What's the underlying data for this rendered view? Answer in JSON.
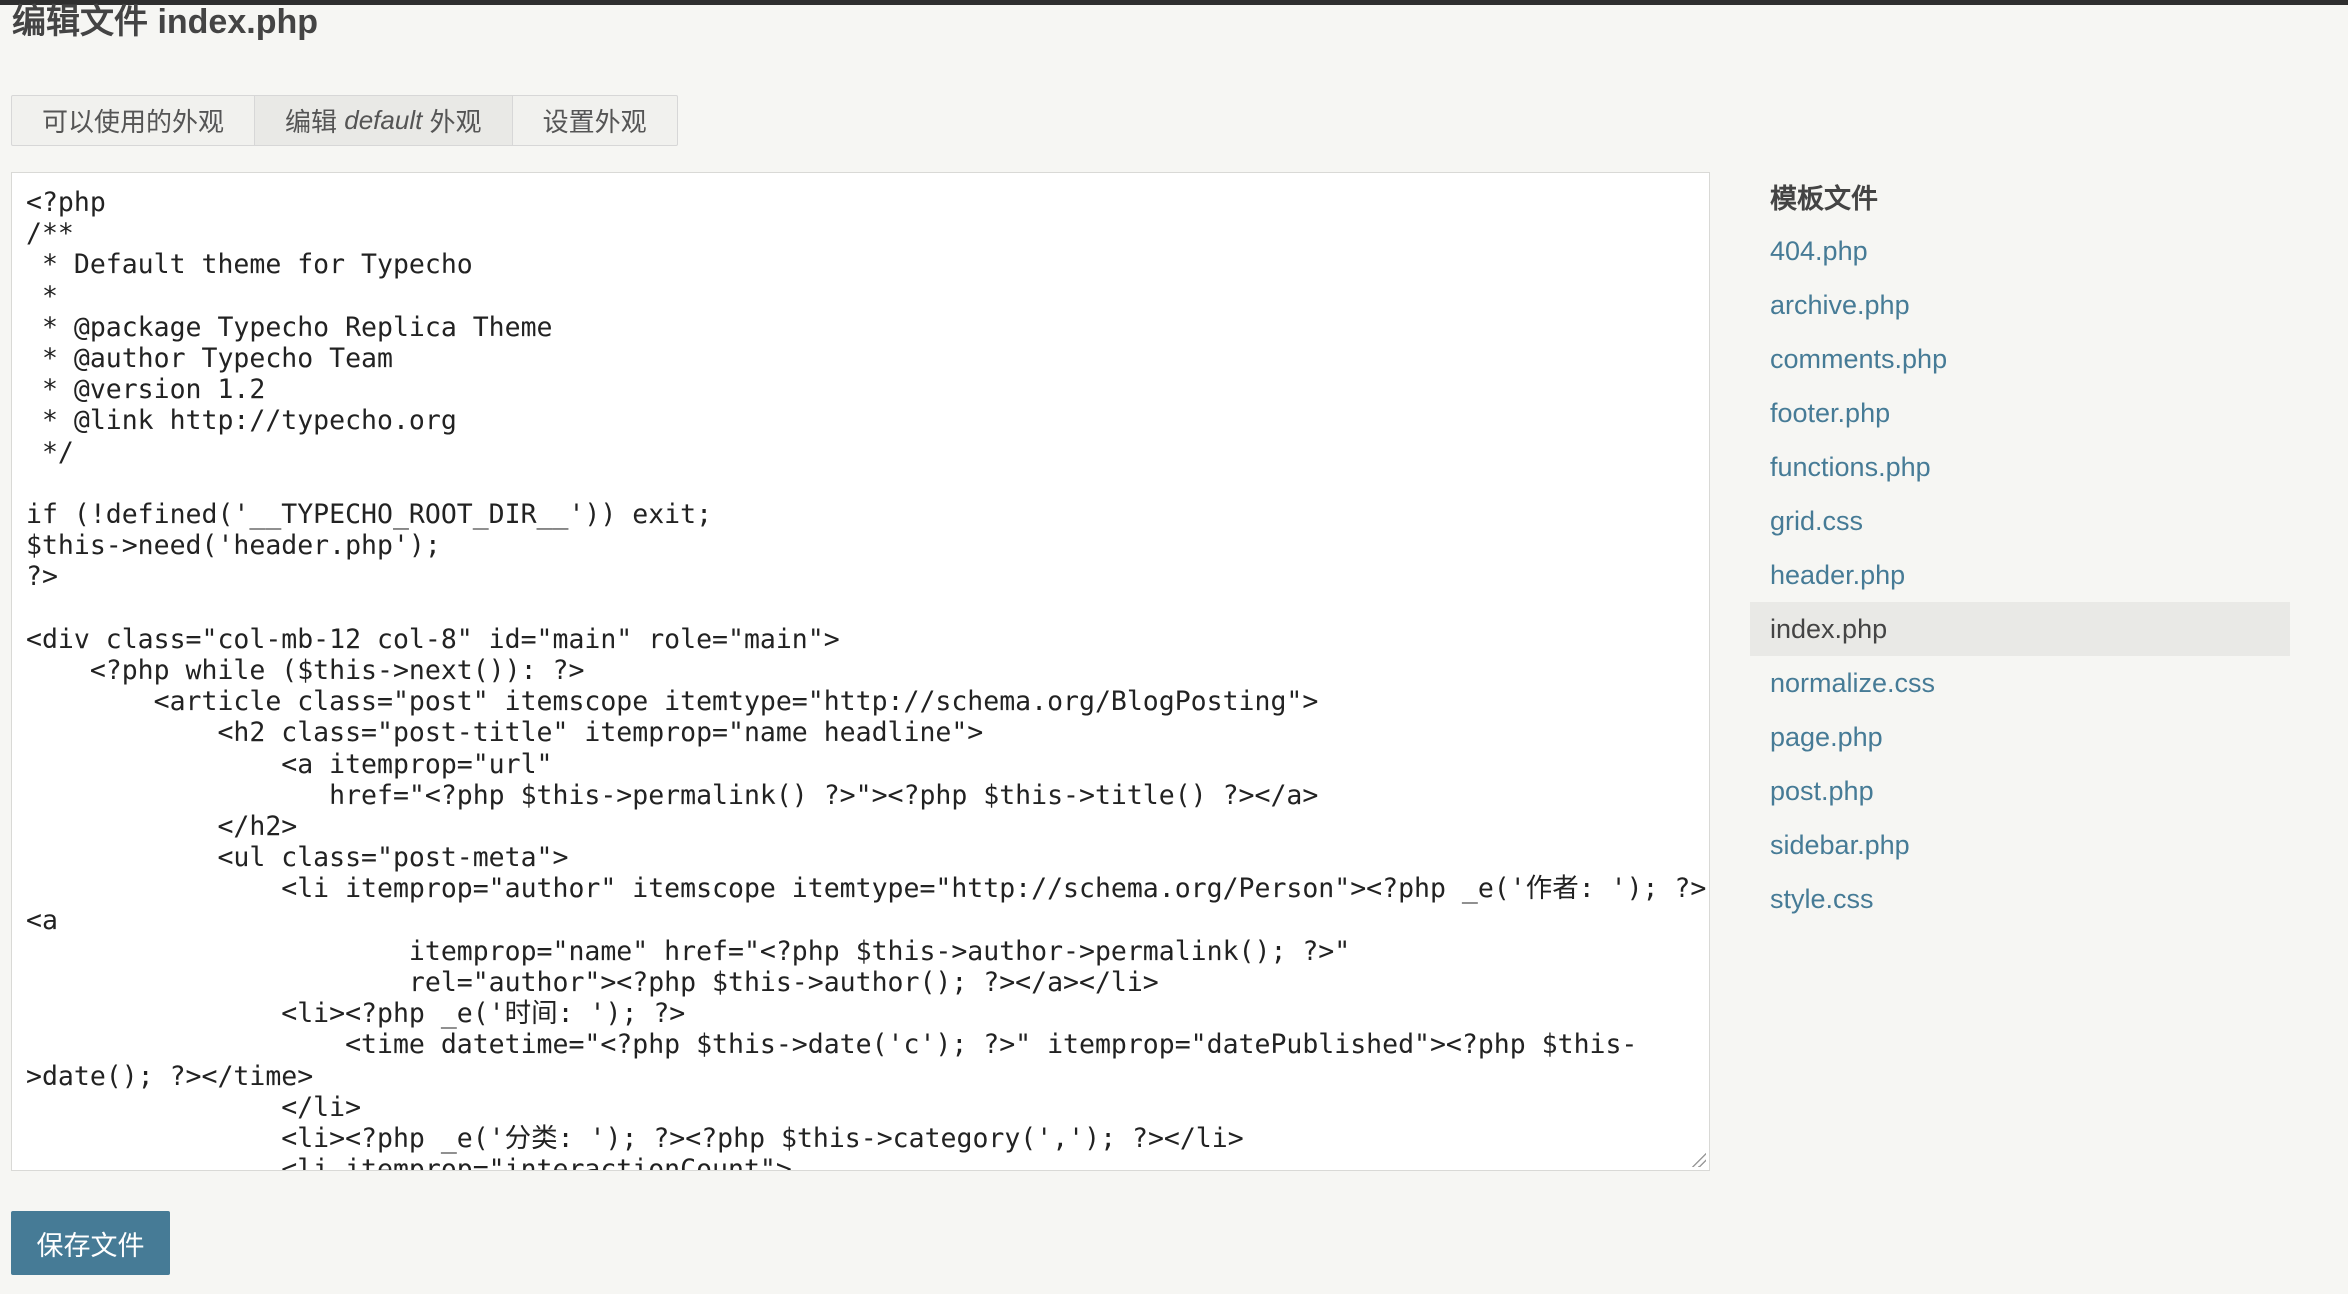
{
  "page": {
    "title": "编辑文件 index.php"
  },
  "tabs": [
    {
      "label": "可以使用的外观"
    },
    {
      "label_prefix": "编辑 ",
      "label_theme": "default",
      "label_suffix": " 外观"
    },
    {
      "label": "设置外观"
    }
  ],
  "editor": {
    "content": "<?php\n/**\n * Default theme for Typecho\n *\n * @package Typecho Replica Theme\n * @author Typecho Team\n * @version 1.2\n * @link http://typecho.org\n */\n\nif (!defined('__TYPECHO_ROOT_DIR__')) exit;\n$this->need('header.php');\n?>\n\n<div class=\"col-mb-12 col-8\" id=\"main\" role=\"main\">\n    <?php while ($this->next()): ?>\n        <article class=\"post\" itemscope itemtype=\"http://schema.org/BlogPosting\">\n            <h2 class=\"post-title\" itemprop=\"name headline\">\n                <a itemprop=\"url\"\n                   href=\"<?php $this->permalink() ?>\"><?php $this->title() ?></a>\n            </h2>\n            <ul class=\"post-meta\">\n                <li itemprop=\"author\" itemscope itemtype=\"http://schema.org/Person\"><?php _e('作者: '); ?>\n<a\n                        itemprop=\"name\" href=\"<?php $this->author->permalink(); ?>\"\n                        rel=\"author\"><?php $this->author(); ?></a></li>\n                <li><?php _e('时间: '); ?>\n                    <time datetime=\"<?php $this->date('c'); ?>\" itemprop=\"datePublished\"><?php $this-\n>date(); ?></time>\n                </li>\n                <li><?php _e('分类: '); ?><?php $this->category(','); ?></li>\n                <li itemprop=\"interactionCount\">"
  },
  "sidebar": {
    "heading": "模板文件",
    "files": [
      {
        "name": "404.php"
      },
      {
        "name": "archive.php"
      },
      {
        "name": "comments.php"
      },
      {
        "name": "footer.php"
      },
      {
        "name": "functions.php"
      },
      {
        "name": "grid.css"
      },
      {
        "name": "header.php"
      },
      {
        "name": "index.php",
        "current": true
      },
      {
        "name": "normalize.css"
      },
      {
        "name": "page.php"
      },
      {
        "name": "post.php"
      },
      {
        "name": "sidebar.php"
      },
      {
        "name": "style.css"
      }
    ]
  },
  "actions": {
    "save_label": "保存文件"
  },
  "colors": {
    "link": "#467b96",
    "button_bg": "#467b96",
    "page_bg": "#f6f6f3",
    "active_bg": "#e9e9e6"
  }
}
